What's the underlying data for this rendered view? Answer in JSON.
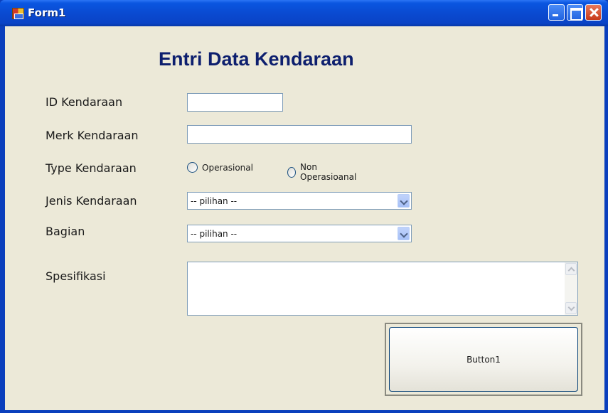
{
  "window": {
    "title": "Form1",
    "controls": {
      "minimize_icon": "minimize-icon",
      "maximize_icon": "maximize-icon",
      "close_icon": "close-icon"
    }
  },
  "form": {
    "heading": "Entri Data Kendaraan",
    "id_label": "ID Kendaraan",
    "id_value": "",
    "merk_label": "Merk Kendaraan",
    "merk_value": "",
    "type_label": "Type Kendaraan",
    "type_options": [
      "Operasional",
      "Non Operasioanal"
    ],
    "jenis_label": "Jenis Kendaraan",
    "jenis_selected": "-- pilihan --",
    "bagian_label": "Bagian",
    "bagian_selected": "-- pilihan --",
    "spesifikasi_label": "Spesifikasi",
    "spesifikasi_value": "",
    "button_label": "Button1"
  },
  "colors": {
    "titlebar": "#0a4ad1",
    "form_background": "#ece9d8",
    "heading": "#0d1f6e"
  }
}
